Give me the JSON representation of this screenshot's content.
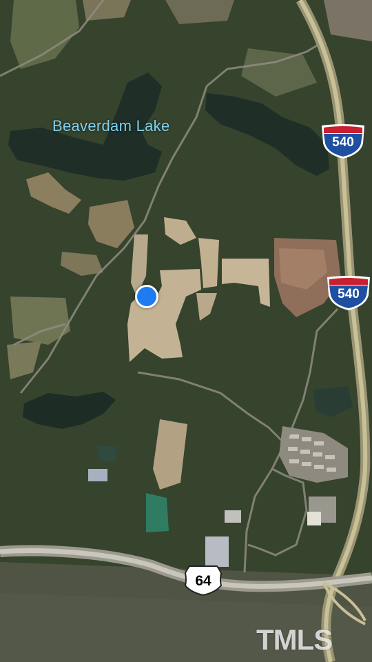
{
  "map": {
    "view": "satellite",
    "lake_label": "Beaverdam Lake",
    "highway_shields": [
      {
        "type": "interstate",
        "number": "540",
        "icon": "interstate-shield-icon"
      },
      {
        "type": "interstate",
        "number": "540",
        "icon": "interstate-shield-icon"
      },
      {
        "type": "us-route",
        "number": "64",
        "icon": "us-route-shield-icon"
      }
    ],
    "current_location_icon": "current-location-dot-icon",
    "watermark": "TMLS",
    "colors": {
      "water_label": "#7fd0ee",
      "location_dot": "#1e7cf2",
      "interstate_blue": "#1f4fa0",
      "interstate_red": "#c8202f"
    }
  }
}
